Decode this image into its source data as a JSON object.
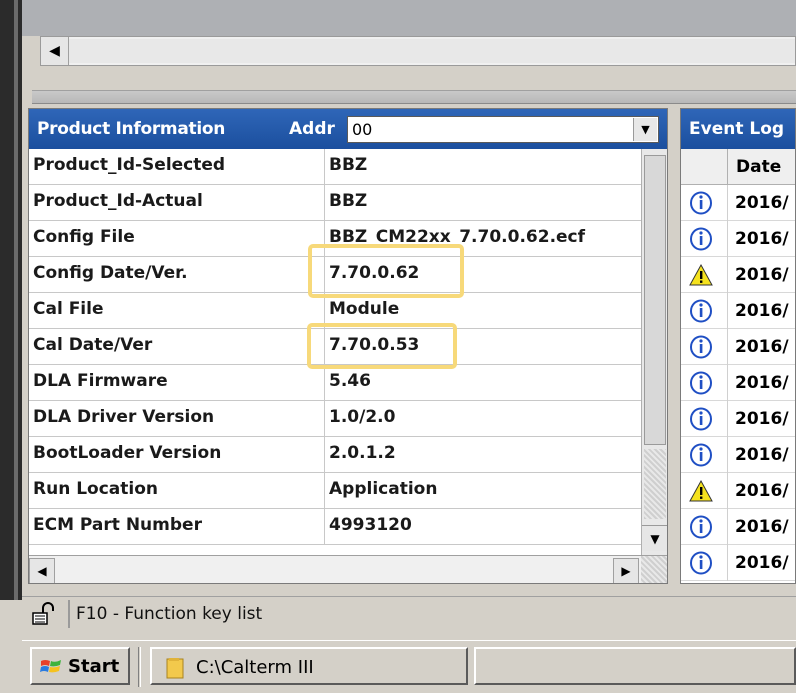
{
  "product_panel": {
    "title": "Product Information",
    "addr_label": "Addr",
    "addr_value": "00",
    "rows": [
      {
        "key": "Product_Id-Selected",
        "value": "BBZ"
      },
      {
        "key": "Product_Id-Actual",
        "value": "BBZ"
      },
      {
        "key": "Config File",
        "value": "BBZ_CM22xx_7.70.0.62.ecf"
      },
      {
        "key": "Config Date/Ver.",
        "value": "7.70.0.62"
      },
      {
        "key": "Cal File",
        "value": "Module"
      },
      {
        "key": "Cal Date/Ver",
        "value": "7.70.0.53"
      },
      {
        "key": "DLA Firmware",
        "value": "5.46"
      },
      {
        "key": "DLA Driver Version",
        "value": "1.0/2.0"
      },
      {
        "key": "BootLoader Version",
        "value": "2.0.1.2"
      },
      {
        "key": "Run Location",
        "value": "Application"
      },
      {
        "key": "ECM Part Number",
        "value": "4993120"
      }
    ]
  },
  "event_log": {
    "title": "Event Log",
    "date_header": "Date",
    "entries": [
      {
        "icon": "info-icon",
        "date": "2016/"
      },
      {
        "icon": "info-icon",
        "date": "2016/"
      },
      {
        "icon": "warning-icon",
        "date": "2016/"
      },
      {
        "icon": "info-icon",
        "date": "2016/"
      },
      {
        "icon": "info-icon",
        "date": "2016/"
      },
      {
        "icon": "info-icon",
        "date": "2016/"
      },
      {
        "icon": "info-icon",
        "date": "2016/"
      },
      {
        "icon": "info-icon",
        "date": "2016/"
      },
      {
        "icon": "warning-icon",
        "date": "2016/"
      },
      {
        "icon": "info-icon",
        "date": "2016/"
      },
      {
        "icon": "info-icon",
        "date": "2016/"
      }
    ]
  },
  "status_bar": {
    "text": "F10 - Function key list"
  },
  "taskbar": {
    "start_label": "Start",
    "window_label": "C:\\Calterm III"
  },
  "colors": {
    "header_blue": "#1b4f9e",
    "highlight": "#f7d97a",
    "info_blue": "#1f4fc4",
    "warning_yellow": "#f5e21e"
  }
}
